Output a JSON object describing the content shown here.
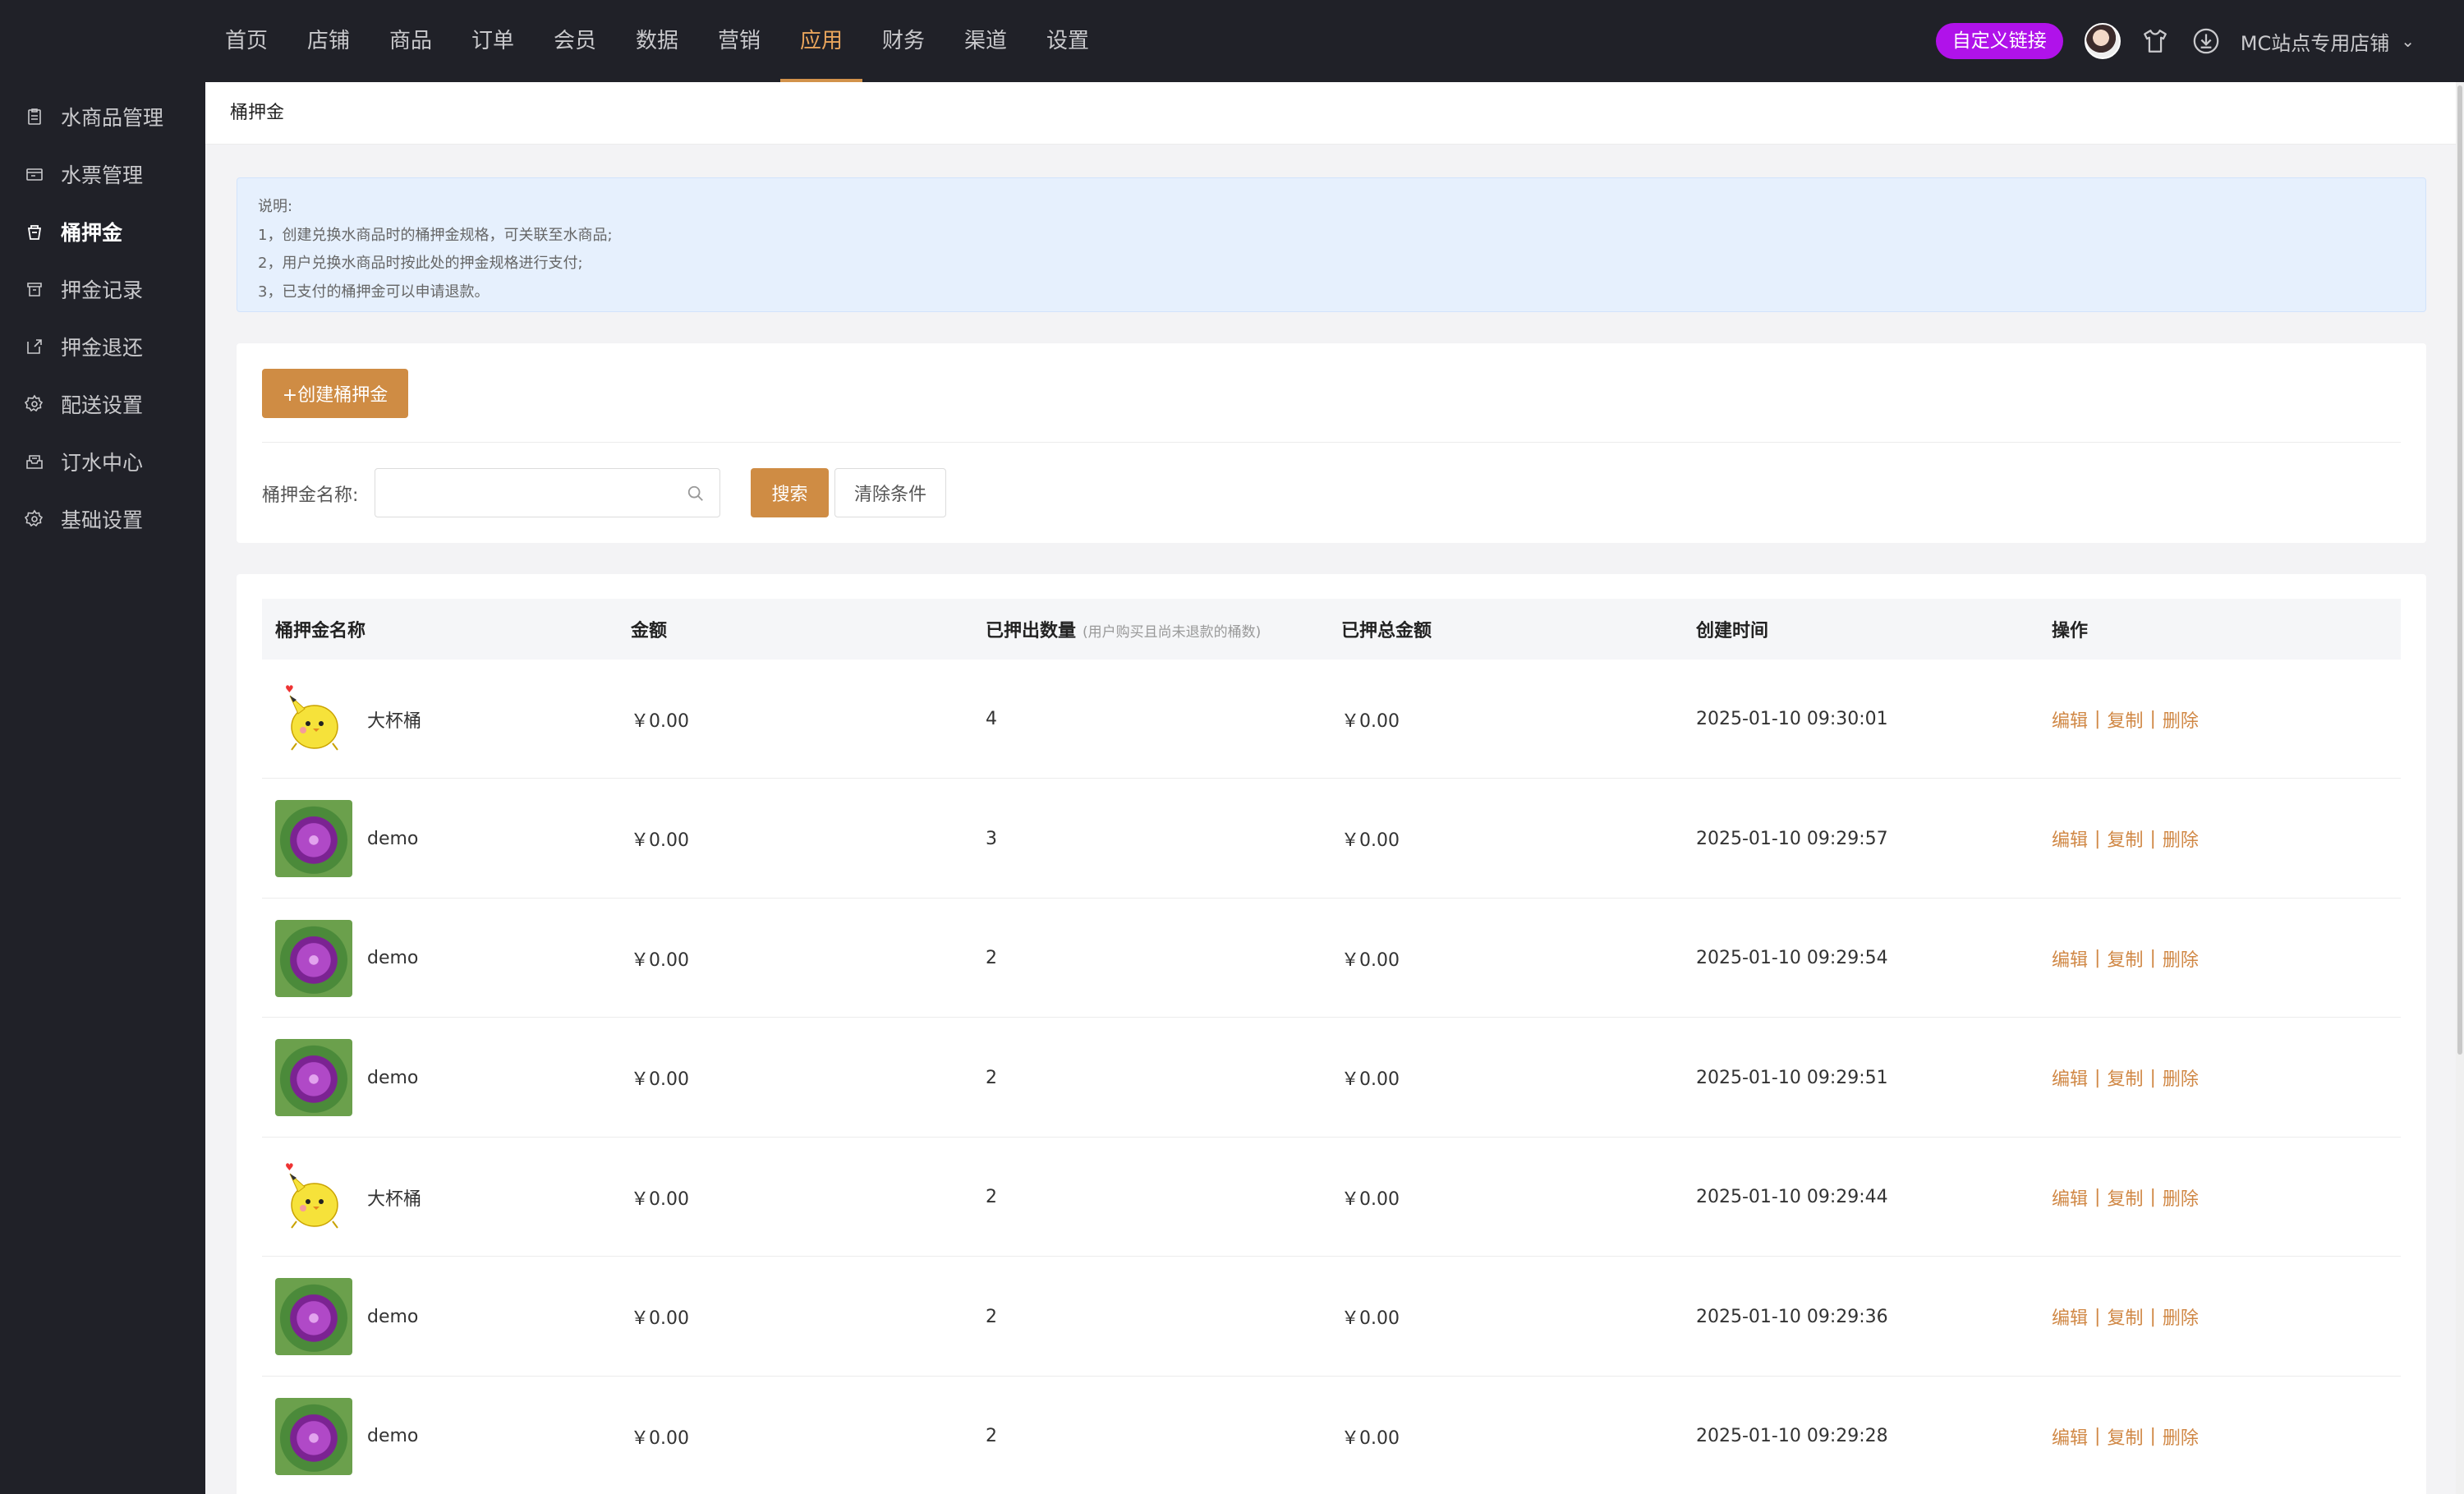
{
  "topnav": {
    "items": [
      "首页",
      "店铺",
      "商品",
      "订单",
      "会员",
      "数据",
      "营销",
      "应用",
      "财务",
      "渠道",
      "设置"
    ],
    "active_index": 7,
    "custom_link_label": "自定义链接",
    "store_name": "MC站点专用店铺"
  },
  "sidebar": {
    "items": [
      {
        "label": "水商品管理",
        "icon": "clipboard-icon"
      },
      {
        "label": "水票管理",
        "icon": "ticket-icon"
      },
      {
        "label": "桶押金",
        "icon": "bucket-icon"
      },
      {
        "label": "押金记录",
        "icon": "record-icon"
      },
      {
        "label": "押金退还",
        "icon": "refund-icon"
      },
      {
        "label": "配送设置",
        "icon": "gear-icon"
      },
      {
        "label": "订水中心",
        "icon": "inbox-icon"
      },
      {
        "label": "基础设置",
        "icon": "gear-icon"
      }
    ],
    "active_index": 2
  },
  "page": {
    "title": "桶押金"
  },
  "notice": {
    "lines": [
      "说明:",
      "1，创建兑换水商品时的桶押金规格，可关联至水商品;",
      "2，用户兑换水商品时按此处的押金规格进行支付;",
      "3，已支付的桶押金可以申请退款。"
    ]
  },
  "toolbar": {
    "create_label": "+创建桶押金",
    "filter_label": "桶押金名称:",
    "search_placeholder": "",
    "search_label": "搜索",
    "clear_label": "清除条件"
  },
  "table": {
    "columns": [
      "桶押金名称",
      "金额",
      "已押出数量",
      "已押总金额",
      "创建时间",
      "操作"
    ],
    "count_note": "(用户购买且尚未退款的桶数)",
    "actions": [
      "编辑",
      "复制",
      "删除"
    ],
    "rows": [
      {
        "thumb": "chick",
        "name": "大杯桶",
        "amount": "￥0.00",
        "count": "4",
        "total": "￥0.00",
        "time": "2025-01-10 09:30:01"
      },
      {
        "thumb": "flower",
        "name": "demo",
        "amount": "￥0.00",
        "count": "3",
        "total": "￥0.00",
        "time": "2025-01-10 09:29:57"
      },
      {
        "thumb": "flower",
        "name": "demo",
        "amount": "￥0.00",
        "count": "2",
        "total": "￥0.00",
        "time": "2025-01-10 09:29:54"
      },
      {
        "thumb": "flower",
        "name": "demo",
        "amount": "￥0.00",
        "count": "2",
        "total": "￥0.00",
        "time": "2025-01-10 09:29:51"
      },
      {
        "thumb": "chick",
        "name": "大杯桶",
        "amount": "￥0.00",
        "count": "2",
        "total": "￥0.00",
        "time": "2025-01-10 09:29:44"
      },
      {
        "thumb": "flower",
        "name": "demo",
        "amount": "￥0.00",
        "count": "2",
        "total": "￥0.00",
        "time": "2025-01-10 09:29:36"
      },
      {
        "thumb": "flower",
        "name": "demo",
        "amount": "￥0.00",
        "count": "2",
        "total": "￥0.00",
        "time": "2025-01-10 09:29:28"
      }
    ]
  },
  "colors": {
    "accent": "#cf8c44",
    "nav_bg": "#202128",
    "custom_link": "#b012ea",
    "notice_bg": "#e6f0fd"
  }
}
